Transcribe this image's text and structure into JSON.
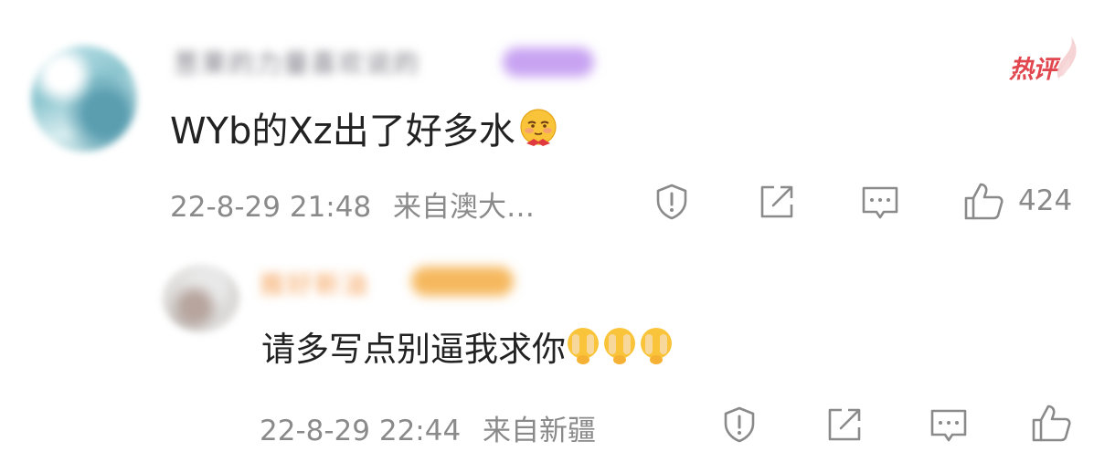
{
  "hot_badge": {
    "label": "热评",
    "color": "#e0474f"
  },
  "comments": [
    {
      "username": "葱果的力量喜欢说的",
      "text": "WYb的Xz出了好多水",
      "timestamp": "22-8-29 21:48",
      "location": "来自澳大…",
      "likes": "424",
      "emoji": "shy-face-emoji"
    },
    {
      "username": "搬好新油",
      "text": "请多写点别逼我求你",
      "timestamp": "22-8-29 22:44",
      "location": "来自新疆",
      "likes": "",
      "emoji": "pleading-hands-emoji"
    }
  ],
  "icons": {
    "report": "report-icon",
    "share": "share-icon",
    "comment": "comment-icon",
    "like": "thumbs-up-icon"
  },
  "colors": {
    "text_primary": "#222222",
    "text_secondary": "#8a8a8a",
    "icon_gray": "#8a8a8a",
    "hot_red": "#e0474f"
  }
}
